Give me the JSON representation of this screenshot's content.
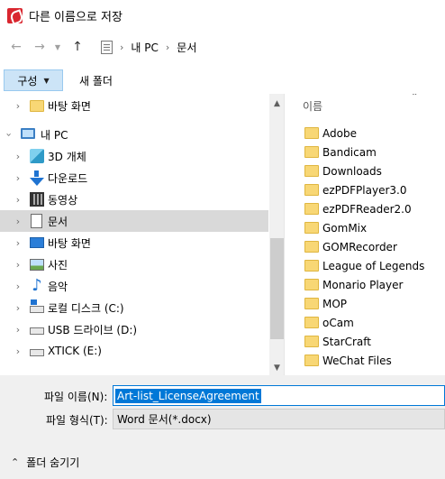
{
  "window": {
    "title": "다른 이름으로 저장",
    "app_icon": "acrobat-icon"
  },
  "nav": {
    "back_icon": "arrow-left-icon",
    "forward_icon": "arrow-right-icon",
    "recent_icon": "chevron-down-icon",
    "up_icon": "arrow-up-icon",
    "breadcrumb": [
      "내 PC",
      "문서"
    ]
  },
  "toolbar": {
    "organize_label": "구성",
    "new_folder_label": "새 폴더"
  },
  "tree": {
    "items": [
      {
        "label": "바탕 화면",
        "icon": "folder-icon"
      },
      {
        "label": "내 PC",
        "icon": "pc-icon"
      },
      {
        "label": "3D 개체",
        "icon": "3d-objects-icon"
      },
      {
        "label": "다운로드",
        "icon": "download-icon"
      },
      {
        "label": "동영상",
        "icon": "video-icon"
      },
      {
        "label": "문서",
        "icon": "document-icon"
      },
      {
        "label": "바탕 화면",
        "icon": "desktop-icon"
      },
      {
        "label": "사진",
        "icon": "picture-icon"
      },
      {
        "label": "음악",
        "icon": "music-icon"
      },
      {
        "label": "로컬 디스크 (C:)",
        "icon": "drive-icon"
      },
      {
        "label": "USB 드라이브 (D:)",
        "icon": "usb-drive-icon"
      },
      {
        "label": "XTICK (E:)",
        "icon": "drive-icon"
      }
    ]
  },
  "files": {
    "column_header": "이름",
    "items": [
      "Adobe",
      "Bandicam",
      "Downloads",
      "ezPDFPlayer3.0",
      "ezPDFReader2.0",
      "GomMix",
      "GOMRecorder",
      "League of Legends",
      "Monario Player",
      "MOP",
      "oCam",
      "StarCraft",
      "WeChat Files"
    ]
  },
  "save": {
    "filename_label": "파일 이름(N):",
    "filename_value": "Art-list_LicenseAgreement",
    "filetype_label": "파일 형식(T):",
    "filetype_value": "Word 문서(*.docx)",
    "hide_folders_label": "폴더 숨기기"
  },
  "colors": {
    "selection": "#0078d7",
    "organize_bg": "#cce4f7",
    "tree_selected_bg": "#d9d9d9",
    "folder_yellow": "#f8d775"
  }
}
